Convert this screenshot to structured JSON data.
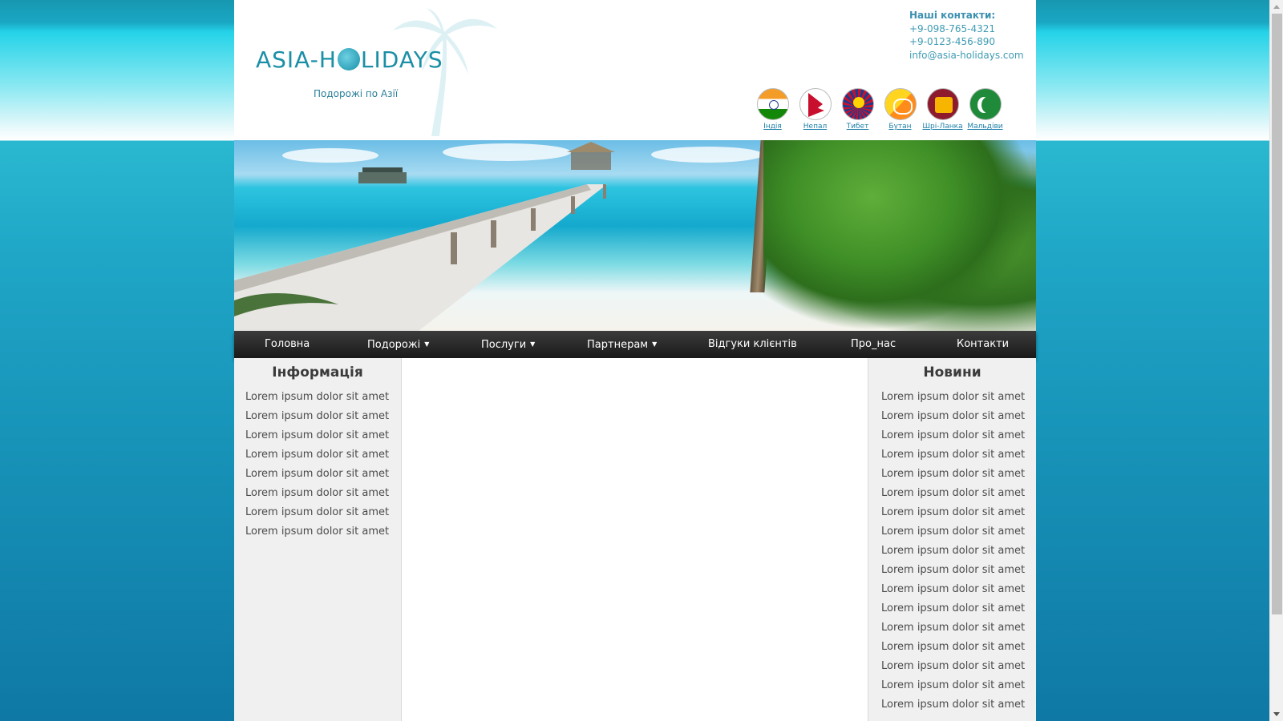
{
  "site": {
    "logo_text_left": "ASIA-H",
    "logo_text_right": "LIDAYS",
    "tagline": "Подорожі по Азії"
  },
  "contacts": {
    "title": "Наші контакти:",
    "phone1": "+9-098-765-4321",
    "phone2": "+9-0123-456-890",
    "email": "info@asia-holidays.com"
  },
  "flags": [
    {
      "label": "Індія",
      "icon": "india-flag-icon"
    },
    {
      "label": "Непал",
      "icon": "nepal-flag-icon"
    },
    {
      "label": "Тибет",
      "icon": "tibet-flag-icon"
    },
    {
      "label": "Бутан",
      "icon": "bhutan-flag-icon"
    },
    {
      "label": "Шрі-Ланка",
      "icon": "sri-lanka-flag-icon"
    },
    {
      "label": "Мальдіви",
      "icon": "maldives-flag-icon"
    }
  ],
  "nav": {
    "items": [
      {
        "label": "Головна",
        "dropdown": false
      },
      {
        "label": "Подорожі",
        "dropdown": true
      },
      {
        "label": "Послуги",
        "dropdown": true
      },
      {
        "label": "Партнерам",
        "dropdown": true
      },
      {
        "label": "Відгуки клієнтів",
        "dropdown": false
      },
      {
        "label": "Про_нас",
        "dropdown": false
      },
      {
        "label": "Контакти",
        "dropdown": false
      }
    ],
    "caret": "▼"
  },
  "info": {
    "title": "Інформація",
    "items": [
      "Lorem ipsum dolor sit amet",
      "Lorem ipsum dolor sit amet",
      "Lorem ipsum dolor sit amet",
      "Lorem ipsum dolor sit amet",
      "Lorem ipsum dolor sit amet",
      "Lorem ipsum dolor sit amet",
      "Lorem ipsum dolor sit amet",
      "Lorem ipsum dolor sit amet"
    ]
  },
  "news": {
    "title": "Новини",
    "items": [
      "Lorem ipsum dolor sit amet",
      "Lorem ipsum dolor sit amet",
      "Lorem ipsum dolor sit amet",
      "Lorem ipsum dolor sit amet",
      "Lorem ipsum dolor sit amet",
      "Lorem ipsum dolor sit amet",
      "Lorem ipsum dolor sit amet",
      "Lorem ipsum dolor sit amet",
      "Lorem ipsum dolor sit amet",
      "Lorem ipsum dolor sit amet",
      "Lorem ipsum dolor sit amet",
      "Lorem ipsum dolor sit amet",
      "Lorem ipsum dolor sit amet",
      "Lorem ipsum dolor sit amet",
      "Lorem ipsum dolor sit amet",
      "Lorem ipsum dolor sit amet",
      "Lorem ipsum dolor sit amet"
    ]
  },
  "colors": {
    "brand": "#1b8fa6",
    "nav_bg": "#2a2a2a",
    "sidebar_bg": "#f0f0f0"
  }
}
